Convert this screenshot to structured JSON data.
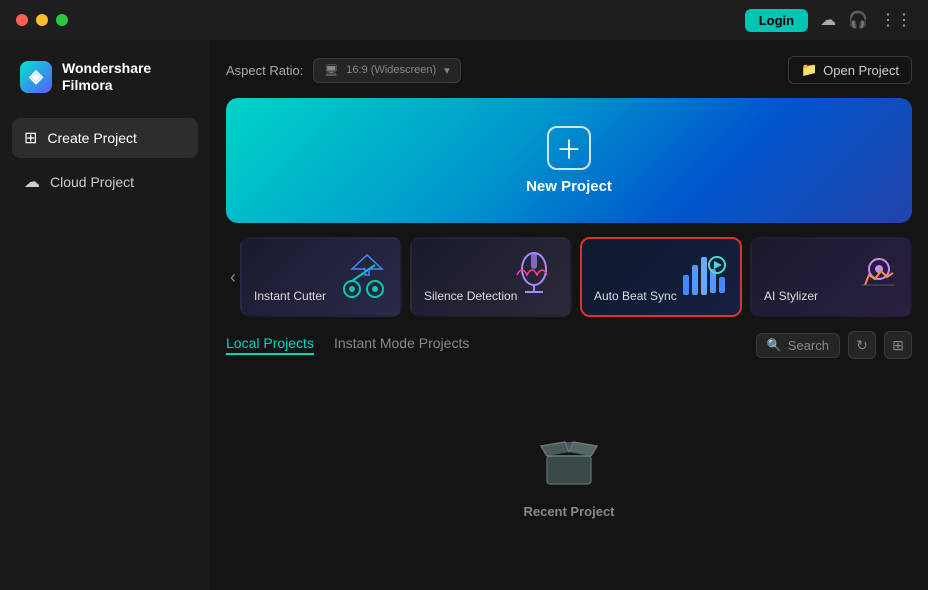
{
  "titlebar": {
    "login_label": "Login",
    "controls": [
      "close",
      "minimize",
      "maximize"
    ]
  },
  "brand": {
    "name_line1": "Wondershare",
    "name_line2": "Filmora"
  },
  "sidebar": {
    "items": [
      {
        "id": "create-project",
        "label": "Create Project",
        "active": true
      },
      {
        "id": "cloud-project",
        "label": "Cloud Project",
        "active": false
      }
    ]
  },
  "aspect_ratio": {
    "label": "Aspect Ratio:",
    "value": "16:9 (Widescreen)"
  },
  "open_project": {
    "label": "Open Project"
  },
  "new_project": {
    "label": "New Project"
  },
  "feature_cards": [
    {
      "id": "instant-cutter",
      "label": "Instant Cutter",
      "selected": false
    },
    {
      "id": "silence-detection",
      "label": "Silence Detection",
      "selected": false
    },
    {
      "id": "auto-beat-sync",
      "label": "Auto Beat Sync",
      "selected": true
    },
    {
      "id": "ai-stylizer",
      "label": "AI Stylizer",
      "selected": false
    }
  ],
  "tabs": [
    {
      "id": "local-projects",
      "label": "Local Projects",
      "active": true
    },
    {
      "id": "instant-mode",
      "label": "Instant Mode Projects",
      "active": false
    }
  ],
  "search": {
    "placeholder": "Search"
  },
  "empty_state": {
    "label": "Recent Project"
  }
}
